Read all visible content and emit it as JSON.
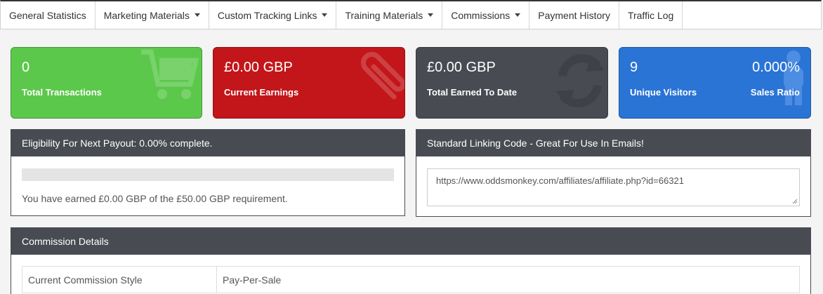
{
  "nav": {
    "items": [
      {
        "label": "General Statistics",
        "dropdown": false
      },
      {
        "label": "Marketing Materials",
        "dropdown": true
      },
      {
        "label": "Custom Tracking Links",
        "dropdown": true
      },
      {
        "label": "Training Materials",
        "dropdown": true
      },
      {
        "label": "Commissions",
        "dropdown": true
      },
      {
        "label": "Payment History",
        "dropdown": false
      },
      {
        "label": "Traffic Log",
        "dropdown": false
      }
    ]
  },
  "stats": {
    "transactions": {
      "value": "0",
      "label": "Total Transactions",
      "color": "#5cc84b",
      "icon": "shopping-cart-icon"
    },
    "earnings": {
      "value": "£0.00 GBP",
      "label": "Current Earnings",
      "color": "#c3161a",
      "icon": "paperclip-icon"
    },
    "earned_to_date": {
      "value": "£0.00 GBP",
      "label": "Total Earned To Date",
      "color": "#484c52",
      "icon": "refresh-icon"
    },
    "visitors": {
      "value": "9",
      "label": "Unique Visitors",
      "ratio_value": "0.000%",
      "ratio_label": "Sales Ratio",
      "color": "#2a74d6",
      "icon": "users-icon"
    }
  },
  "eligibility": {
    "title": "Eligibility For Next Payout: 0.00% complete.",
    "progress_percent": 0,
    "earned_text": "You have earned £0.00 GBP of the £50.00 GBP requirement."
  },
  "linking": {
    "title": "Standard Linking Code - Great For Use In Emails!",
    "url": "https://www.oddsmonkey.com/affiliates/affiliate.php?id=66321"
  },
  "commission": {
    "title": "Commission Details",
    "rows": [
      {
        "label": "Current Commission Style",
        "value": "Pay-Per-Sale"
      }
    ]
  }
}
